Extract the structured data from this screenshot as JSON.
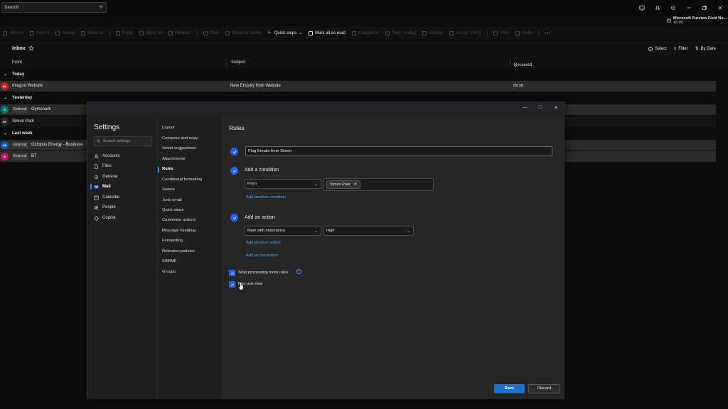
{
  "titlebar": {
    "search_placeholder": "Search",
    "account_name": "Microsoft Purview Field No...",
    "account_time": "15:00"
  },
  "ribbon": {
    "items": [
      {
        "label": "Archive",
        "icon": "archive-icon",
        "enabled": false
      },
      {
        "label": "Report",
        "icon": "report-icon",
        "enabled": false
      },
      {
        "label": "Sweep",
        "icon": "sweep-icon",
        "enabled": false
      },
      {
        "label": "Move to",
        "icon": "move-icon",
        "enabled": false
      },
      {
        "label": "Reply",
        "icon": "reply-icon",
        "enabled": false
      },
      {
        "label": "Reply all",
        "icon": "reply-all-icon",
        "enabled": false
      },
      {
        "label": "Forward",
        "icon": "forward-icon",
        "enabled": false
      },
      {
        "label": "Chat",
        "icon": "chat-icon",
        "enabled": false
      },
      {
        "label": "Share to Teams",
        "icon": "teams-icon",
        "enabled": false
      },
      {
        "label": "Quick steps",
        "icon": "lightning-icon",
        "enabled": true
      },
      {
        "label": "Mark all as read",
        "icon": "envelope-open-icon",
        "enabled": true
      },
      {
        "label": "Categorize",
        "icon": "tag-icon",
        "enabled": false
      },
      {
        "label": "Flag / Unflag",
        "icon": "flag-icon",
        "enabled": false
      },
      {
        "label": "Snooze",
        "icon": "clock-icon",
        "enabled": false
      },
      {
        "label": "Assign policy",
        "icon": "policy-icon",
        "enabled": false
      },
      {
        "label": "Print",
        "icon": "print-icon",
        "enabled": false
      },
      {
        "label": "Undo",
        "icon": "undo-icon",
        "enabled": false
      }
    ]
  },
  "inbox": {
    "title": "Inbox",
    "tools": {
      "select": "Select",
      "filter": "Filter",
      "sort": "By Date"
    },
    "columns": {
      "from": "From",
      "subject": "Subject",
      "received": "Received"
    },
    "groups": {
      "today": "Today",
      "yesterday": "Yesterday",
      "last_week": "Last week"
    },
    "rows": [
      {
        "initials": "IW",
        "color": "#c62828",
        "from": "Integral Website",
        "external": "",
        "subject": "New Enquiry from Website",
        "time": "09:36"
      },
      {
        "initials": "G",
        "color": "#00796b",
        "from": "Gymshark",
        "external": "External",
        "subject": "",
        "time": ""
      },
      {
        "initials": "SP",
        "color": "#2b2b2b",
        "from": "Simon Park",
        "external": "",
        "subject": "",
        "time": ""
      },
      {
        "initials": "OB",
        "color": "#0d5ba8",
        "from": "Octopus Energy - Business",
        "external": "External",
        "subject": "",
        "time": ""
      },
      {
        "initials": "B",
        "color": "#c2185b",
        "from": "BT",
        "external": "External",
        "subject": "",
        "time": ""
      }
    ]
  },
  "settings": {
    "title": "Settings",
    "search_placeholder": "Search settings",
    "categories": [
      {
        "label": "Accounts",
        "icon": "person-icon"
      },
      {
        "label": "Files",
        "icon": "file-icon"
      },
      {
        "label": "General",
        "icon": "gear-icon"
      },
      {
        "label": "Mail",
        "icon": "mail-icon"
      },
      {
        "label": "Calendar",
        "icon": "calendar-icon"
      },
      {
        "label": "People",
        "icon": "people-icon"
      },
      {
        "label": "Copilot",
        "icon": "copilot-icon"
      }
    ],
    "selected_category": "Mail",
    "subcategories": [
      "Layout",
      "Compose and reply",
      "Smart suggestions",
      "Attachments",
      "Rules",
      "Conditional formatting",
      "Sweep",
      "Junk email",
      "Quick steps",
      "Customize actions",
      "Message handling",
      "Forwarding",
      "Retention policies",
      "S/MIME",
      "Groups"
    ],
    "selected_subcategory": "Rules"
  },
  "rules": {
    "title": "Rules",
    "rule_name": "Flag Emails from Simon",
    "add_condition": "Add a condition",
    "condition_field": "From",
    "condition_value": "Simon Park",
    "add_another_condition": "Add another condition",
    "add_action": "Add an action",
    "action_field": "Mark with importance",
    "action_value": "High",
    "add_another_action": "Add another action",
    "add_exception": "Add an exception",
    "stop_processing": "Stop processing more rules",
    "run_rule_now": "Run rule now",
    "save": "Save",
    "discard": "Discard"
  },
  "colors": {
    "accent": "#2563eb",
    "link": "#4d9fff",
    "save_button": "#1f6fd1"
  }
}
